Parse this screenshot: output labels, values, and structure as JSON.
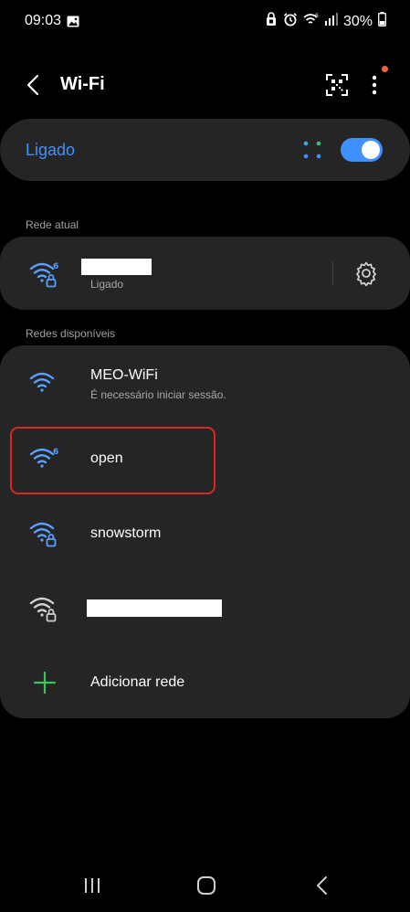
{
  "status_bar": {
    "time": "09:03",
    "battery": "30%",
    "icons": [
      "gallery-icon",
      "lock-icon",
      "alarm-icon",
      "wifi-6-icon",
      "signal-icon",
      "battery-icon"
    ]
  },
  "header": {
    "title": "Wi-Fi",
    "back_icon": "back-arrow-icon",
    "qr_icon": "qr-code-scanner-icon",
    "more_icon": "more-vert-icon"
  },
  "master_toggle": {
    "label": "Ligado",
    "state": "on"
  },
  "current_network": {
    "section_label": "Rede atual",
    "name_hidden": true,
    "status": "Ligado",
    "icon": "wifi-6-lock-icon"
  },
  "available": {
    "section_label": "Redes disponíveis",
    "networks": [
      {
        "name": "MEO-WiFi",
        "subtitle": "É necessário iniciar sessão.",
        "icon": "wifi-icon"
      },
      {
        "name": "open",
        "subtitle": "",
        "icon": "wifi-6-icon"
      },
      {
        "name": "snowstorm",
        "subtitle": "",
        "icon": "wifi-lock-icon"
      },
      {
        "name": "",
        "subtitle": "",
        "icon": "wifi-lock-icon"
      }
    ],
    "add_label": "Adicionar rede"
  },
  "colors": {
    "accent": "#3e91ff",
    "wifi_blue": "#5aa0ff",
    "card": "#252525",
    "highlight": "#d9262c",
    "add_green": "#3ec35a",
    "notif_dot": "#f0643c"
  }
}
